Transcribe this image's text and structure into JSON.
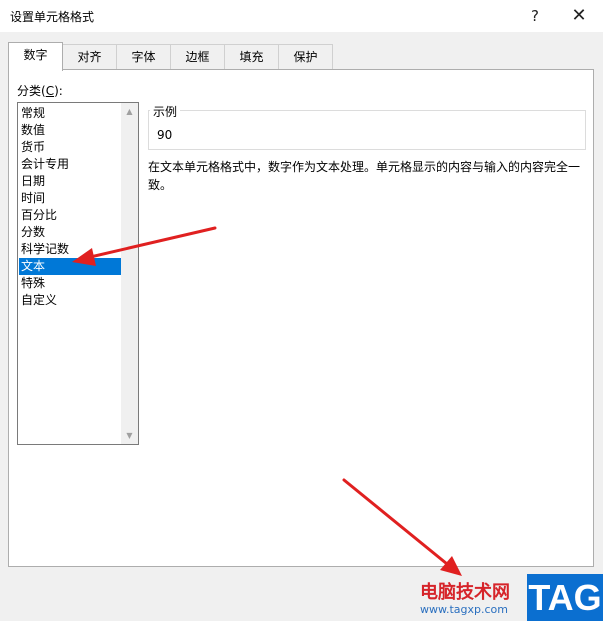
{
  "window": {
    "title": "设置单元格格式",
    "help_label": "?",
    "close_label": "✕"
  },
  "tabs": [
    {
      "label": "数字",
      "active": true
    },
    {
      "label": "对齐",
      "active": false
    },
    {
      "label": "字体",
      "active": false
    },
    {
      "label": "边框",
      "active": false
    },
    {
      "label": "填充",
      "active": false
    },
    {
      "label": "保护",
      "active": false
    }
  ],
  "category": {
    "label_prefix": "分类(",
    "label_accel": "C",
    "label_suffix": "):",
    "items": [
      "常规",
      "数值",
      "货币",
      "会计专用",
      "日期",
      "时间",
      "百分比",
      "分数",
      "科学记数",
      "文本",
      "特殊",
      "自定义"
    ],
    "selected": "文本"
  },
  "sample": {
    "label": "示例",
    "value": "90"
  },
  "description": "在文本单元格格式中，数字作为文本处理。单元格显示的内容与输入的内容完全一致。",
  "watermark": {
    "site_name": "电脑技术网",
    "url": "www.tagxp.com",
    "tag": "TAG"
  },
  "colors": {
    "selection": "#0078d7",
    "annotation_arrow": "#e02020"
  }
}
